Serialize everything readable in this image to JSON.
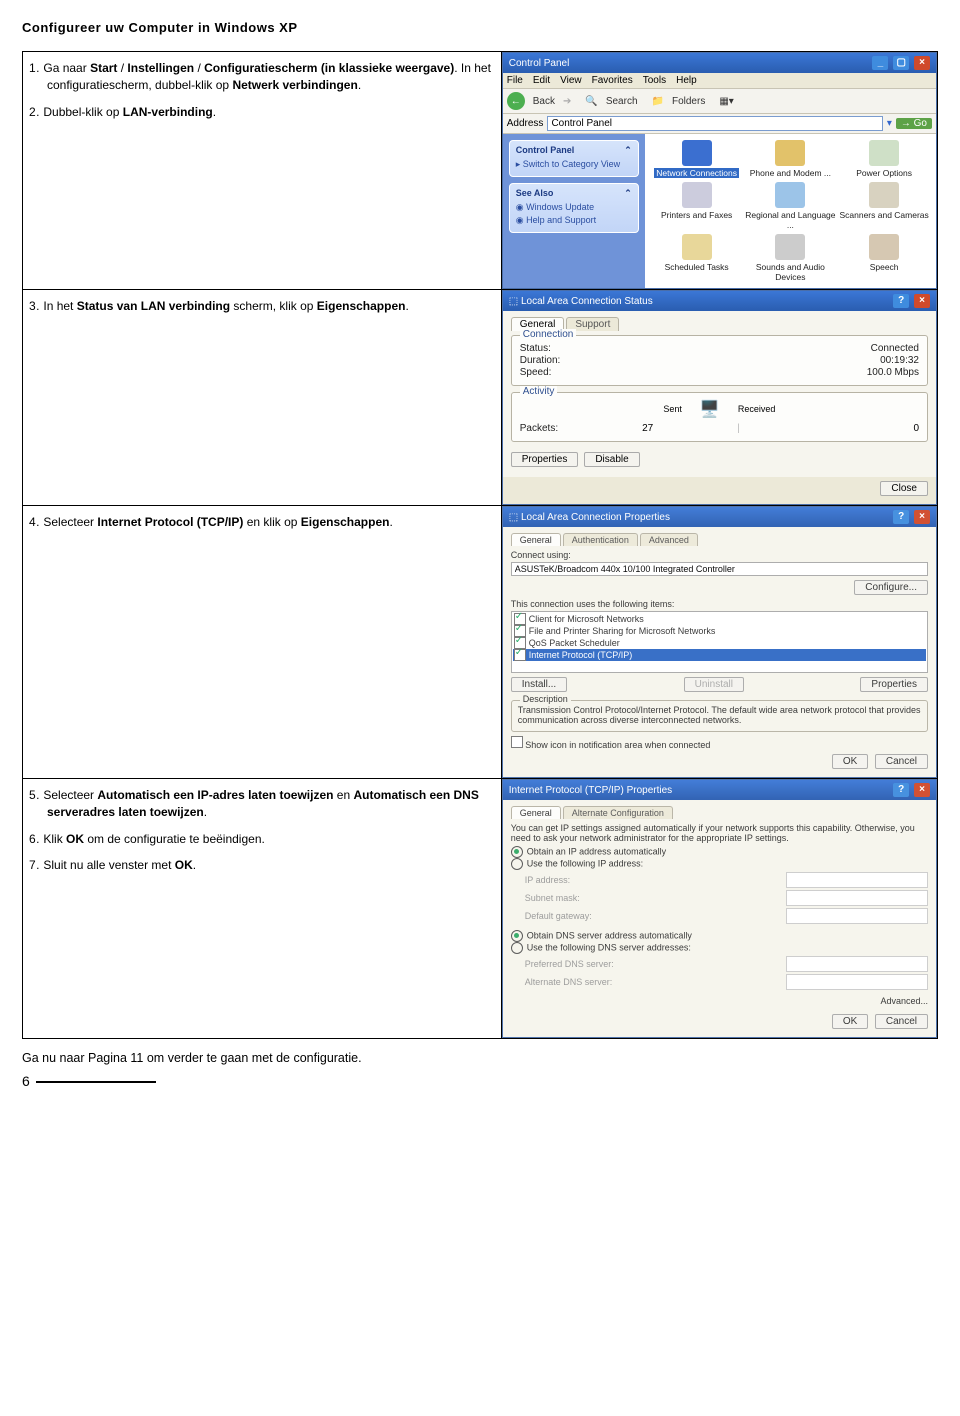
{
  "page": {
    "title": "Configureer uw Computer in Windows XP",
    "footer_note": "Ga nu naar Pagina 11 om verder te gaan met de configuratie.",
    "page_number": "6"
  },
  "steps": {
    "s1": {
      "num": "1.",
      "pre": "Ga naar ",
      "b1": "Start",
      "mid1": " / ",
      "b2": "Instellingen",
      "mid2": " / ",
      "b3": "Configuratiescherm (in klassieke weergave)",
      "post1": ". In het configuratiescherm, dubbel-klik op ",
      "b4": "Netwerk verbindingen",
      "post2": "."
    },
    "s2": {
      "num": "2.",
      "pre": "Dubbel-klik op ",
      "b1": "LAN-verbinding",
      "post": "."
    },
    "s3": {
      "num": "3.",
      "pre": "In het ",
      "b1": "Status van LAN verbinding",
      "mid": " scherm, klik op ",
      "b2": "Eigenschappen",
      "post": "."
    },
    "s4": {
      "num": "4.",
      "pre": "Selecteer ",
      "b1": "Internet Protocol (TCP/IP)",
      "mid": " en klik op ",
      "b2": "Eigenschappen",
      "post": "."
    },
    "s5": {
      "num": "5.",
      "pre": "Selecteer ",
      "b1": "Automatisch een IP-adres laten toewijzen",
      "mid": " en ",
      "b2": "Automatisch een DNS serveradres laten toewijzen",
      "post": "."
    },
    "s6": {
      "num": "6.",
      "pre": "Klik ",
      "b1": "OK",
      "post": " om de configuratie te beëindigen."
    },
    "s7": {
      "num": "7.",
      "pre": "Sluit nu alle venster met ",
      "b1": "OK",
      "post": "."
    }
  },
  "shot1": {
    "title": "Control Panel",
    "menus": [
      "File",
      "Edit",
      "View",
      "Favorites",
      "Tools",
      "Help"
    ],
    "toolbar": {
      "back": "Back",
      "search": "Search",
      "folders": "Folders"
    },
    "address_label": "Address",
    "address_value": "Control Panel",
    "go": "Go",
    "side_panelbox": {
      "title": "Control Panel",
      "link": "Switch to Category View"
    },
    "side_seealso": {
      "title": "See Also",
      "links": [
        "Windows Update",
        "Help and Support"
      ]
    },
    "items": [
      {
        "label": "Network Connections",
        "selected": true
      },
      {
        "label": "Phone and Modem ..."
      },
      {
        "label": "Power Options"
      },
      {
        "label": "Printers and Faxes"
      },
      {
        "label": "Regional and Language ..."
      },
      {
        "label": "Scanners and Cameras"
      },
      {
        "label": "Scheduled Tasks"
      },
      {
        "label": "Sounds and Audio Devices"
      },
      {
        "label": "Speech"
      }
    ]
  },
  "shot2": {
    "title": "Local Area Connection Status",
    "tabs": [
      "General",
      "Support"
    ],
    "group_connection": "Connection",
    "status_k": "Status:",
    "status_v": "Connected",
    "duration_k": "Duration:",
    "duration_v": "00:19:32",
    "speed_k": "Speed:",
    "speed_v": "100.0 Mbps",
    "group_activity": "Activity",
    "sent": "Sent",
    "received": "Received",
    "packets_k": "Packets:",
    "packets_sent": "27",
    "packets_recv": "0",
    "btn_properties": "Properties",
    "btn_disable": "Disable",
    "btn_close": "Close"
  },
  "shot3": {
    "title": "Local Area Connection Properties",
    "tabs": [
      "General",
      "Authentication",
      "Advanced"
    ],
    "connect_using": "Connect using:",
    "adapter": "ASUSTeK/Broadcom 440x 10/100 Integrated Controller",
    "btn_configure": "Configure...",
    "uses_items": "This connection uses the following items:",
    "items": [
      "Client for Microsoft Networks",
      "File and Printer Sharing for Microsoft Networks",
      "QoS Packet Scheduler",
      "Internet Protocol (TCP/IP)"
    ],
    "btn_install": "Install...",
    "btn_uninstall": "Uninstall",
    "btn_properties": "Properties",
    "desc_legend": "Description",
    "desc_text": "Transmission Control Protocol/Internet Protocol. The default wide area network protocol that provides communication across diverse interconnected networks.",
    "show_icon": "Show icon in notification area when connected",
    "btn_ok": "OK",
    "btn_cancel": "Cancel"
  },
  "shot4": {
    "title": "Internet Protocol (TCP/IP) Properties",
    "tabs": [
      "General",
      "Alternate Configuration"
    ],
    "intro": "You can get IP settings assigned automatically if your network supports this capability. Otherwise, you need to ask your network administrator for the appropriate IP settings.",
    "r1": "Obtain an IP address automatically",
    "r2": "Use the following IP address:",
    "ip_k": "IP address:",
    "mask_k": "Subnet mask:",
    "gw_k": "Default gateway:",
    "r3": "Obtain DNS server address automatically",
    "r4": "Use the following DNS server addresses:",
    "pdns_k": "Preferred DNS server:",
    "adns_k": "Alternate DNS server:",
    "btn_adv": "Advanced...",
    "btn_ok": "OK",
    "btn_cancel": "Cancel"
  }
}
